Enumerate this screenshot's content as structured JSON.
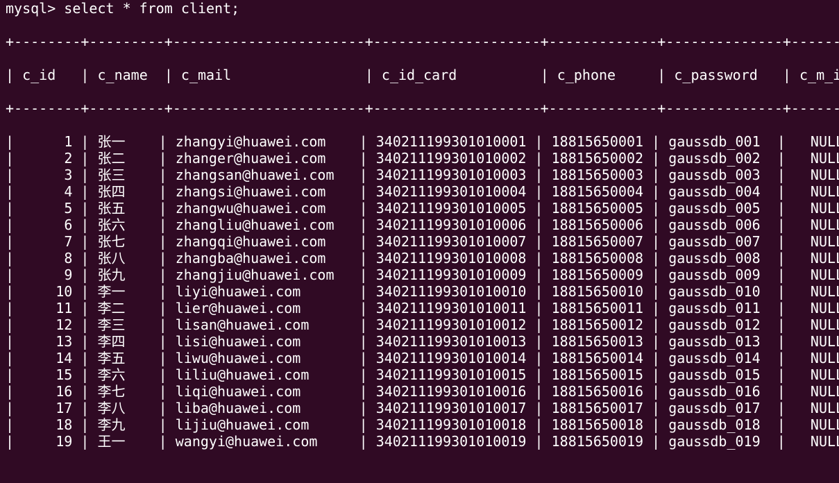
{
  "prompt": "mysql> ",
  "command": "select * from client;",
  "table": {
    "columns": [
      {
        "name": "c_id",
        "width": 6,
        "align": "right"
      },
      {
        "name": "c_name",
        "width": 7,
        "align": "left"
      },
      {
        "name": "c_mail",
        "width": 21,
        "align": "left"
      },
      {
        "name": "c_id_card",
        "width": 18,
        "align": "left"
      },
      {
        "name": "c_phone",
        "width": 11,
        "align": "left"
      },
      {
        "name": "c_password",
        "width": 12,
        "align": "left"
      },
      {
        "name": "c_m_id",
        "width": 6,
        "align": "right"
      }
    ],
    "rows": [
      [
        "1",
        "张一",
        "zhangyi@huawei.com",
        "340211199301010001",
        "18815650001",
        "gaussdb_001",
        "NULL"
      ],
      [
        "2",
        "张二",
        "zhanger@huawei.com",
        "340211199301010002",
        "18815650002",
        "gaussdb_002",
        "NULL"
      ],
      [
        "3",
        "张三",
        "zhangsan@huawei.com",
        "340211199301010003",
        "18815650003",
        "gaussdb_003",
        "NULL"
      ],
      [
        "4",
        "张四",
        "zhangsi@huawei.com",
        "340211199301010004",
        "18815650004",
        "gaussdb_004",
        "NULL"
      ],
      [
        "5",
        "张五",
        "zhangwu@huawei.com",
        "340211199301010005",
        "18815650005",
        "gaussdb_005",
        "NULL"
      ],
      [
        "6",
        "张六",
        "zhangliu@huawei.com",
        "340211199301010006",
        "18815650006",
        "gaussdb_006",
        "NULL"
      ],
      [
        "7",
        "张七",
        "zhangqi@huawei.com",
        "340211199301010007",
        "18815650007",
        "gaussdb_007",
        "NULL"
      ],
      [
        "8",
        "张八",
        "zhangba@huawei.com",
        "340211199301010008",
        "18815650008",
        "gaussdb_008",
        "NULL"
      ],
      [
        "9",
        "张九",
        "zhangjiu@huawei.com",
        "340211199301010009",
        "18815650009",
        "gaussdb_009",
        "NULL"
      ],
      [
        "10",
        "李一",
        "liyi@huawei.com",
        "340211199301010010",
        "18815650010",
        "gaussdb_010",
        "NULL"
      ],
      [
        "11",
        "李二",
        "lier@huawei.com",
        "340211199301010011",
        "18815650011",
        "gaussdb_011",
        "NULL"
      ],
      [
        "12",
        "李三",
        "lisan@huawei.com",
        "340211199301010012",
        "18815650012",
        "gaussdb_012",
        "NULL"
      ],
      [
        "13",
        "李四",
        "lisi@huawei.com",
        "340211199301010013",
        "18815650013",
        "gaussdb_013",
        "NULL"
      ],
      [
        "14",
        "李五",
        "liwu@huawei.com",
        "340211199301010014",
        "18815650014",
        "gaussdb_014",
        "NULL"
      ],
      [
        "15",
        "李六",
        "liliu@huawei.com",
        "340211199301010015",
        "18815650015",
        "gaussdb_015",
        "NULL"
      ],
      [
        "16",
        "李七",
        "liqi@huawei.com",
        "340211199301010016",
        "18815650016",
        "gaussdb_016",
        "NULL"
      ],
      [
        "17",
        "李八",
        "liba@huawei.com",
        "340211199301010017",
        "18815650017",
        "gaussdb_017",
        "NULL"
      ],
      [
        "18",
        "李九",
        "lijiu@huawei.com",
        "340211199301010018",
        "18815650018",
        "gaussdb_018",
        "NULL"
      ],
      [
        "19",
        "王一",
        "wangyi@huawei.com",
        "340211199301010019",
        "18815650019",
        "gaussdb_019",
        "NULL"
      ]
    ]
  },
  "colors": {
    "background": "#300a24",
    "text": "#ffffff"
  }
}
